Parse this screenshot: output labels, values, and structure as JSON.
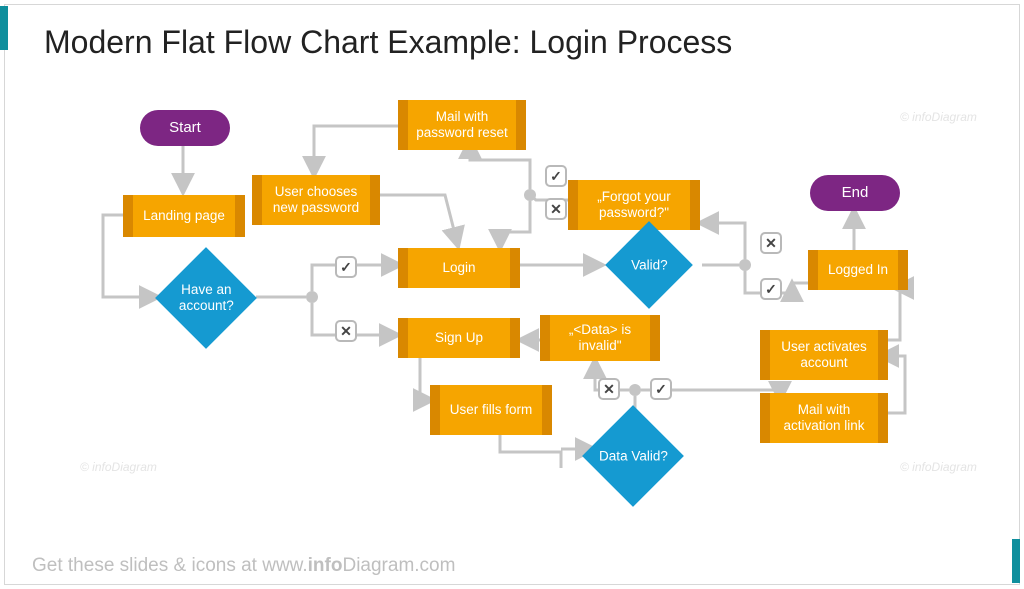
{
  "title": "Modern Flat Flow Chart Example: Login Process",
  "footer_prefix": "Get these slides & icons at ",
  "footer_site_prefix": "www.",
  "footer_site_bold": "info",
  "footer_site_rest": "Diagram",
  "footer_site_tld": ".com",
  "watermark": "© infoDiagram",
  "colors": {
    "terminator": "#7d2683",
    "process": "#f6a500",
    "process_edge": "#d98800",
    "decision": "#159ad1",
    "connector": "#c5c5c5",
    "accent": "#0f8f9d"
  },
  "nodes": {
    "start": {
      "label": "Start"
    },
    "end": {
      "label": "End"
    },
    "landing": {
      "label": "Landing page"
    },
    "newpwd": {
      "label": "User chooses new password"
    },
    "mailreset": {
      "label": "Mail with password reset"
    },
    "forgot": {
      "label": "„Forgot your password?\""
    },
    "login": {
      "label": "Login"
    },
    "signup": {
      "label": "Sign Up"
    },
    "userfills": {
      "label": "User fills form"
    },
    "datainvalid": {
      "label": "„<Data> is invalid\""
    },
    "activates": {
      "label": "User activates account"
    },
    "maillink": {
      "label": "Mail with activation link"
    },
    "loggedin": {
      "label": "Logged In"
    },
    "haveacct": {
      "label": "Have an account?"
    },
    "valid": {
      "label": "Valid?"
    },
    "datavalid": {
      "label": "Data Valid?"
    }
  },
  "gates": {
    "yes": "✓",
    "no": "✕"
  }
}
